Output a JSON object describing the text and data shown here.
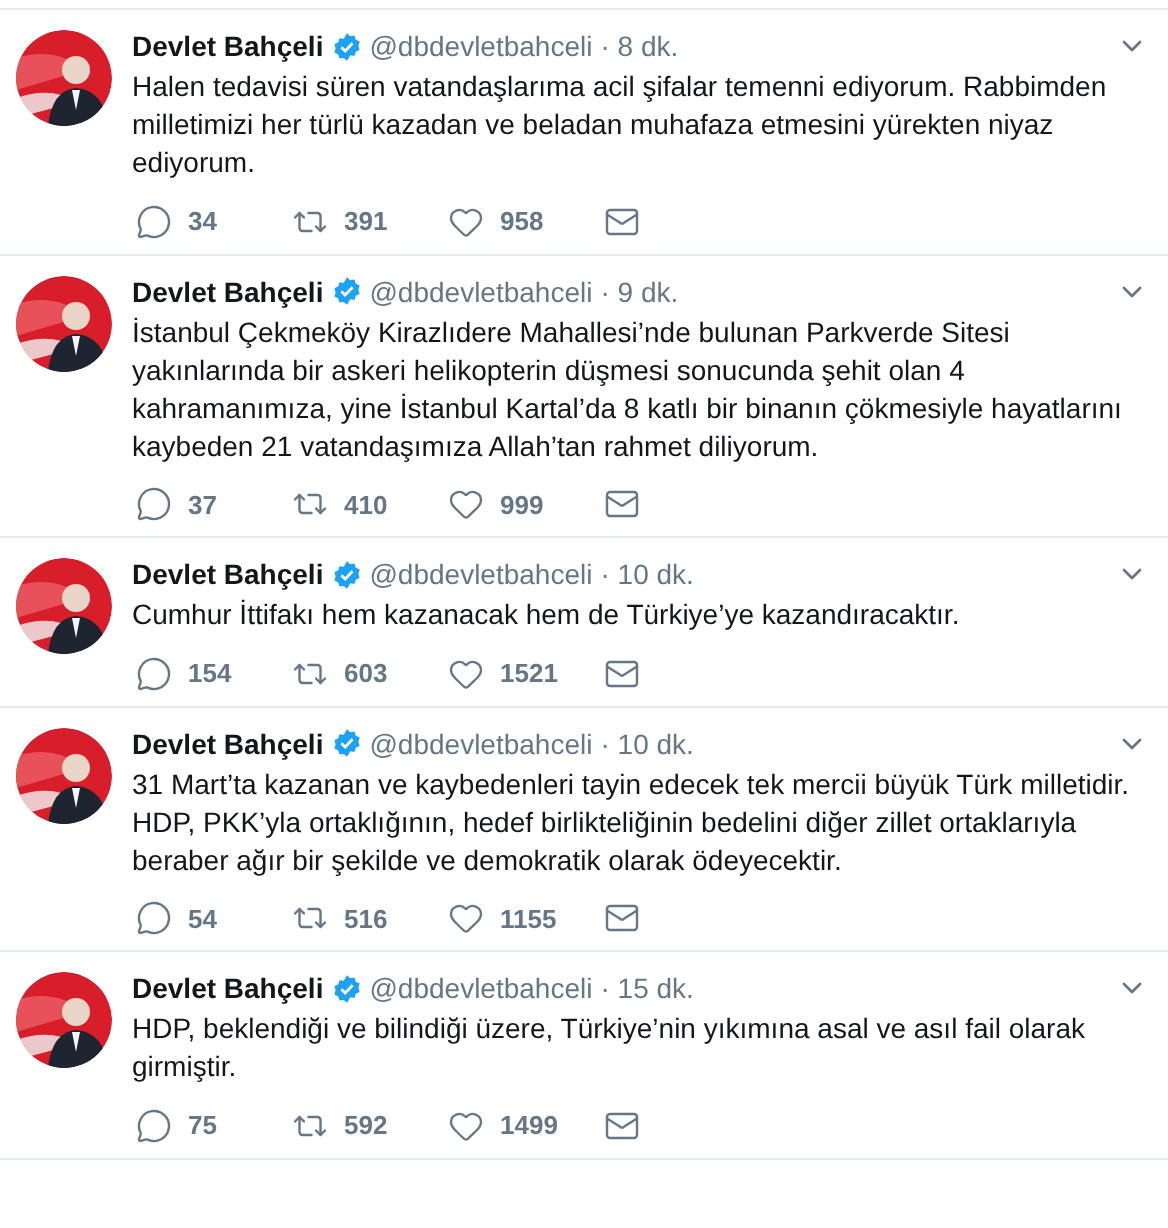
{
  "tweets": [
    {
      "name": "Devlet Bahçeli",
      "handle": "@dbdevletbahceli",
      "time": "· 8 dk.",
      "text": "Halen tedavisi süren vatandaşlarıma acil şifalar temenni ediyorum. Rabbimden milletimizi her türlü kazadan ve beladan muhafaza etmesini yürekten niyaz ediyorum.",
      "replies": "34",
      "retweets": "391",
      "likes": "958"
    },
    {
      "name": "Devlet Bahçeli",
      "handle": "@dbdevletbahceli",
      "time": "· 9 dk.",
      "text": "İstanbul Çekmeköy Kirazlıdere Mahallesi’nde bulunan Parkverde Sitesi yakınlarında bir askeri helikopterin düşmesi sonucunda şehit olan 4 kahramanımıza, yine İstanbul Kartal’da 8 katlı bir binanın çökmesiyle hayatlarını kaybeden 21 vatandaşımıza Allah’tan rahmet diliyorum.",
      "replies": "37",
      "retweets": "410",
      "likes": "999"
    },
    {
      "name": "Devlet Bahçeli",
      "handle": "@dbdevletbahceli",
      "time": "· 10 dk.",
      "text": "Cumhur İttifakı hem kazanacak hem de Türkiye’ye kazandıracaktır.",
      "replies": "154",
      "retweets": "603",
      "likes": "1521"
    },
    {
      "name": "Devlet Bahçeli",
      "handle": "@dbdevletbahceli",
      "time": "· 10 dk.",
      "text": "31 Mart’ta kazanan ve kaybedenleri tayin edecek tek mercii büyük Türk milletidir. HDP, PKK’yla ortaklığının, hedef birlikteliğinin bedelini diğer zillet ortaklarıyla beraber ağır bir şekilde ve demokratik olarak ödeyecektir.",
      "replies": "54",
      "retweets": "516",
      "likes": "1155"
    },
    {
      "name": "Devlet Bahçeli",
      "handle": "@dbdevletbahceli",
      "time": "· 15 dk.",
      "text": "HDP, beklendiği ve bilindiği üzere, Türkiye’nin yıkımına asal ve asıl fail olarak girmiştir.",
      "replies": "75",
      "retweets": "592",
      "likes": "1499"
    }
  ]
}
